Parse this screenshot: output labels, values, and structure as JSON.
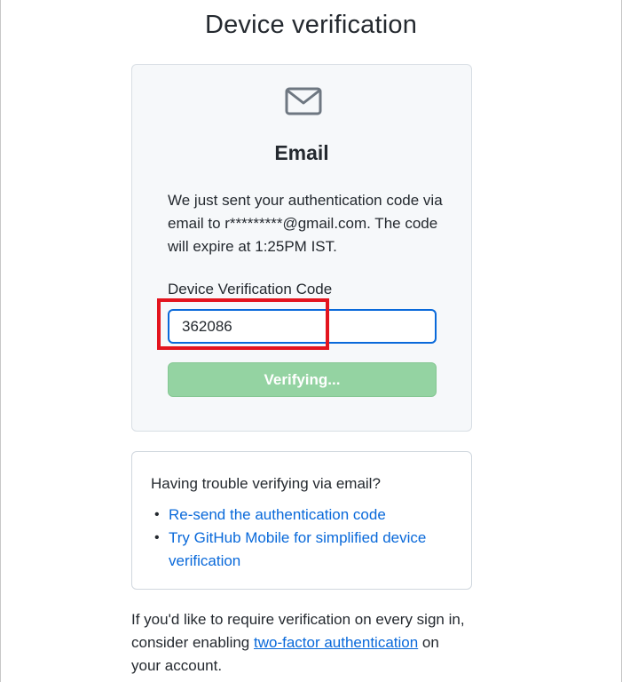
{
  "page": {
    "title": "Device verification"
  },
  "auth_card": {
    "icon": "mail-icon",
    "heading": "Email",
    "message": "We just sent your authentication code via email to r*********@gmail.com. The code will expire at 1:25PM IST.",
    "field_label": "Device Verification Code",
    "code_value": "362086",
    "button_label": "Verifying..."
  },
  "trouble": {
    "heading": "Having trouble verifying via email?",
    "links": [
      "Re-send the authentication code",
      "Try GitHub Mobile for simplified device verification"
    ]
  },
  "footer": {
    "prefix": "If you'd like to require verification on every sign in, consider enabling ",
    "link": "two-factor authentication",
    "suffix": " on your account."
  },
  "colors": {
    "link": "#0969da",
    "button_disabled": "#94d3a2",
    "focus_border": "#0969da",
    "highlight": "#e3141e",
    "card_bg": "#f6f8fa"
  }
}
